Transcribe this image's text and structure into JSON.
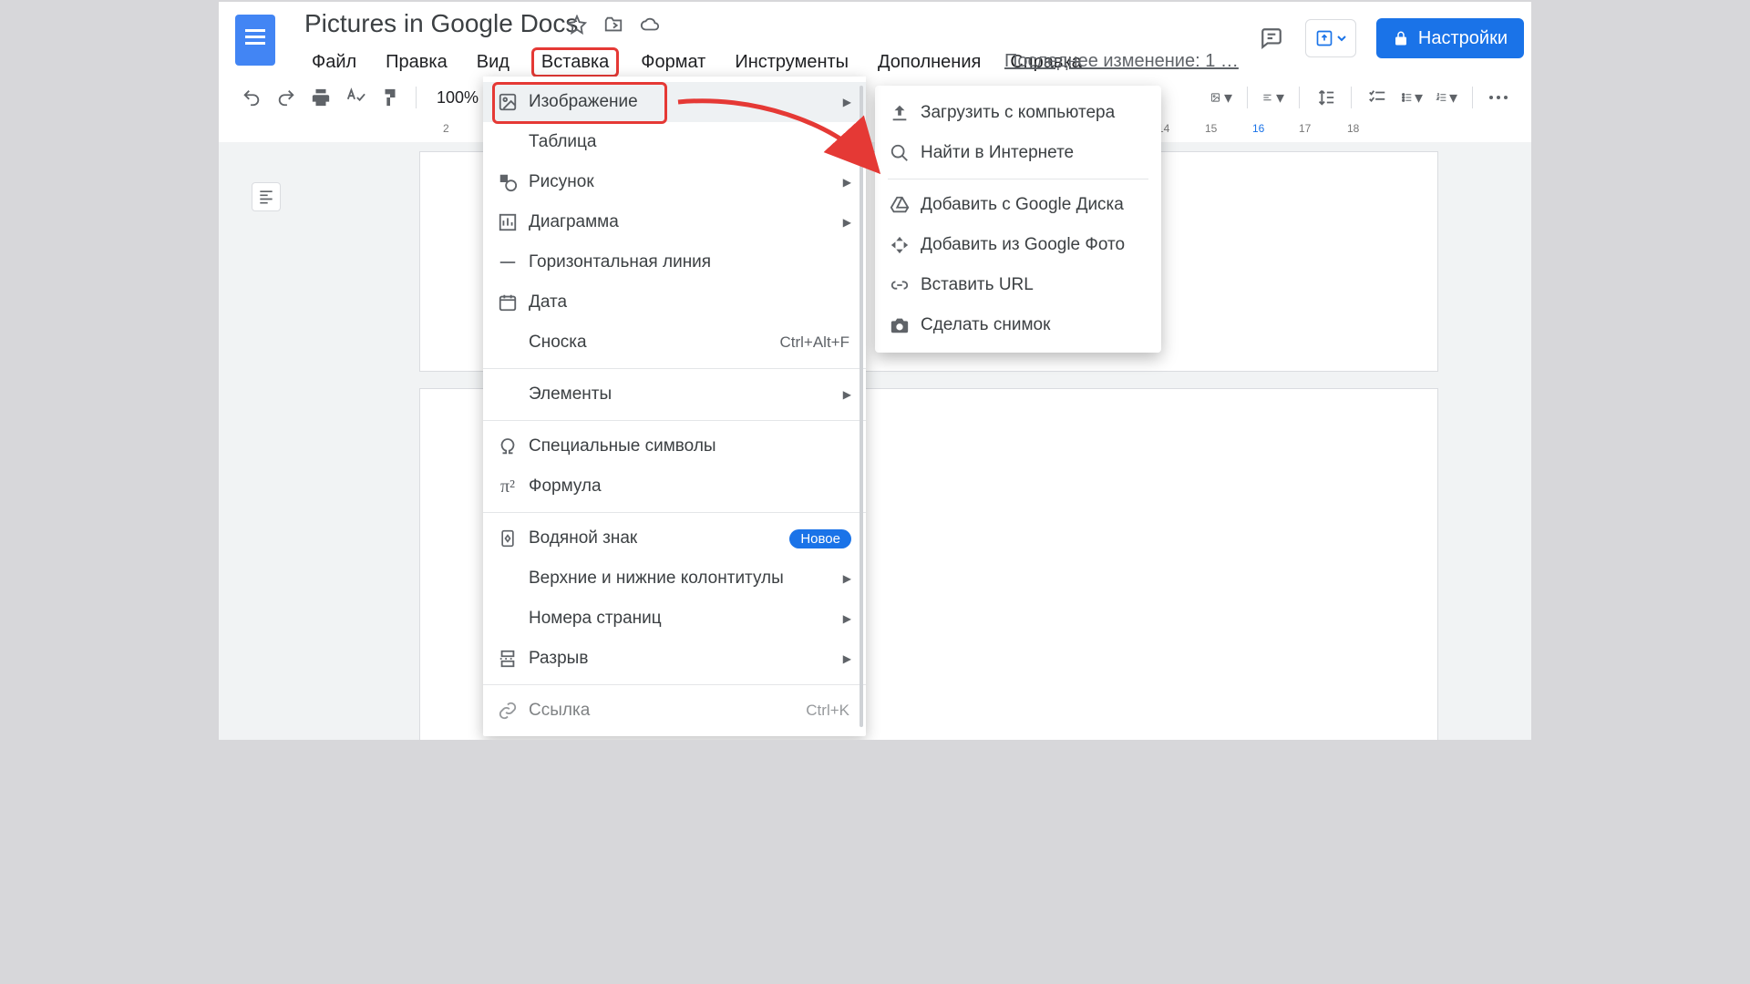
{
  "title": "Pictures in Google Docs",
  "menubar": {
    "file": "Файл",
    "edit": "Правка",
    "view": "Вид",
    "insert": "Вставка",
    "format": "Формат",
    "tools": "Инструменты",
    "addons": "Дополнения",
    "help": "Справка"
  },
  "lastEdit": "Последнее изменение: 1 …",
  "shareLabel": "Настройки",
  "toolbar": {
    "zoom": "100%"
  },
  "ruler": {
    "t2": "2",
    "t14": "14",
    "t15": "15",
    "t16": "16",
    "t17": "17",
    "t18": "18"
  },
  "insertMenu": {
    "image": "Изображение",
    "table": "Таблица",
    "drawing": "Рисунок",
    "chart": "Диаграмма",
    "hr": "Горизонтальная линия",
    "date": "Дата",
    "footnote": "Сноска",
    "footnoteShortcut": "Ctrl+Alt+F",
    "elements": "Элементы",
    "specialChars": "Специальные символы",
    "equation": "Формула",
    "watermark": "Водяной знак",
    "watermarkBadge": "Новое",
    "headersFooters": "Верхние и нижние колонтитулы",
    "pageNumbers": "Номера страниц",
    "break": "Разрыв",
    "link": "Ссылка",
    "linkShortcut": "Ctrl+K"
  },
  "imageSubmenu": {
    "upload": "Загрузить с компьютера",
    "searchWeb": "Найти в Интернете",
    "drive": "Добавить с Google Диска",
    "photos": "Добавить из Google Фото",
    "url": "Вставить URL",
    "camera": "Сделать снимок"
  }
}
